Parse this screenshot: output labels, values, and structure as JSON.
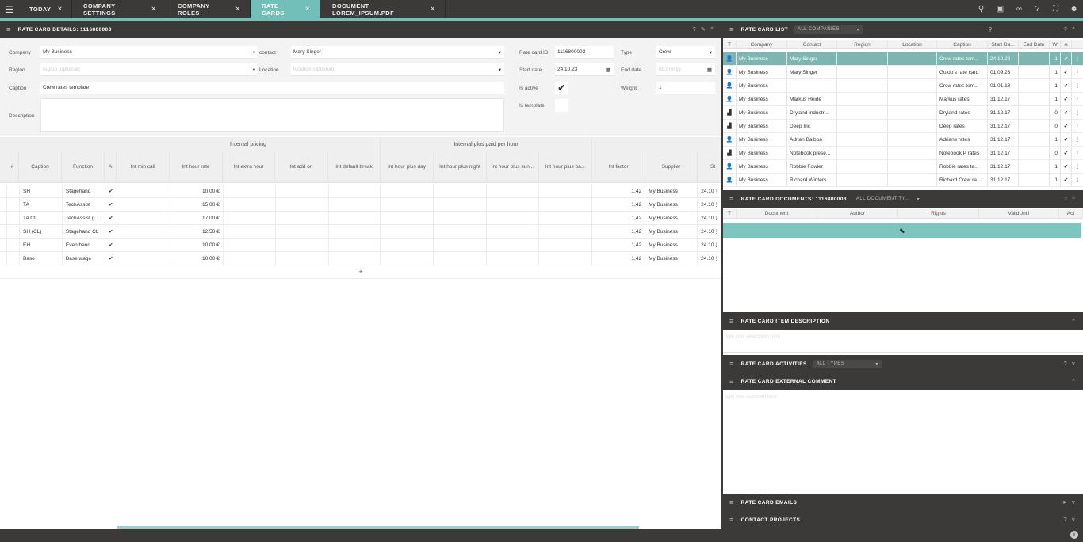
{
  "tabs": [
    {
      "label": "TODAY",
      "close": "×"
    },
    {
      "label": "COMPANY SETTINGS",
      "close": "×"
    },
    {
      "label": "COMPANY ROLES",
      "close": "×"
    },
    {
      "label": "RATE CARDS",
      "close": "×"
    },
    {
      "label": "DOCUMENT LOREM_IPSUM.PDF",
      "close": "×"
    }
  ],
  "details": {
    "title": "RATE CARD DETAILS: 1116800003",
    "company_label": "Company",
    "company": "My Business",
    "contact_label": "contact",
    "contact": "Mary Singer",
    "region_label": "Region",
    "region_ph": "region (optional)",
    "location_label": "Location",
    "location_ph": "location (optional)",
    "caption_label": "Caption",
    "caption": "Crew rates template",
    "description_label": "Description",
    "id_label": "Rate card ID",
    "id": "1116800003",
    "type_label": "Type",
    "type": "Crew",
    "start_label": "Start date",
    "start": "24.10.23",
    "end_label": "End date",
    "end_ph": "dd.mm.yy",
    "active_label": "Is active",
    "weight_label": "Weight",
    "weight": "1",
    "template_label": "Is template"
  },
  "grid": {
    "group1": "Internal pricing",
    "group2": "Internal plus paid per hour",
    "columns": [
      "#",
      "Caption",
      "Function",
      "A",
      "Int min call",
      "Int hour rate",
      "Int extra hour",
      "Int add on",
      "Int default break",
      "Int hour plus day",
      "Int hour plus night",
      "Int hour plus sun...",
      "Int hour plus ba...",
      "Int factor",
      "Supplier",
      "St"
    ],
    "rows": [
      {
        "caption": "SH",
        "function": "Stagehand",
        "rate": "10,00 €",
        "factor": "1,42",
        "supplier": "My Business",
        "st": "24.10"
      },
      {
        "caption": "TA",
        "function": "TechAssist",
        "rate": "15,00 €",
        "factor": "1,42",
        "supplier": "My Business",
        "st": "24.10"
      },
      {
        "caption": "TA CL",
        "function": "TechAssist (...",
        "rate": "17,00 €",
        "factor": "1,42",
        "supplier": "My Business",
        "st": "24.10"
      },
      {
        "caption": "SH (CL)",
        "function": "Stagehand CL",
        "rate": "12,50 €",
        "factor": "1,42",
        "supplier": "My Business",
        "st": "24.10"
      },
      {
        "caption": "EH",
        "function": "Eventhand",
        "rate": "10,00 €",
        "factor": "1,42",
        "supplier": "My Business",
        "st": "24.10"
      },
      {
        "caption": "Base",
        "function": "Base wage",
        "rate": "10,00 €",
        "factor": "1,42",
        "supplier": "My Business",
        "st": "24.10"
      }
    ],
    "add": "+"
  },
  "list": {
    "title": "RATE CARD LIST",
    "filter": "ALL COMPANIES",
    "columns": [
      "T",
      "Company",
      "Contact",
      "Region",
      "Location",
      "Caption",
      "Start Da...",
      "End Date",
      "W",
      "A"
    ],
    "rows": [
      {
        "icon": "person",
        "company": "My Business",
        "contact": "Mary Singer",
        "caption": "Crew rates tem...",
        "start": "24.10.23",
        "w": "1"
      },
      {
        "icon": "person",
        "company": "My Business",
        "contact": "Mary Singer",
        "caption": "Guido's rate card",
        "start": "01.09.23",
        "w": "1"
      },
      {
        "icon": "person",
        "company": "My Business",
        "contact": "",
        "caption": "Crew rates tem...",
        "start": "01.01.18",
        "w": "1"
      },
      {
        "icon": "person",
        "company": "My Business",
        "contact": "Markus Heide",
        "caption": "Markus rates",
        "start": "31.12.17",
        "w": "1"
      },
      {
        "icon": "factory",
        "company": "My Business",
        "contact": "Dryland industri...",
        "caption": "Dryland rates",
        "start": "31.12.17",
        "w": "0"
      },
      {
        "icon": "factory",
        "company": "My Business",
        "contact": "Deep Inc",
        "caption": "Deep rates",
        "start": "31.12.17",
        "w": "0"
      },
      {
        "icon": "person",
        "company": "My Business",
        "contact": "Adrian Balboa",
        "caption": "Adrians rates",
        "start": "31.12.17",
        "w": "1"
      },
      {
        "icon": "factory",
        "company": "My Business",
        "contact": "Notebook prese...",
        "caption": "Notebook P rates",
        "start": "31.12.17",
        "w": "0"
      },
      {
        "icon": "person",
        "company": "My Business",
        "contact": "Robbie Fowler",
        "caption": "Robbie rates te...",
        "start": "31.12.17",
        "w": "1"
      },
      {
        "icon": "person",
        "company": "My Business",
        "contact": "Richard Winters",
        "caption": "Richard Crew ra...",
        "start": "31.12.17",
        "w": "1"
      }
    ]
  },
  "documents": {
    "title": "RATE CARD DOCUMENTS: 1116800003",
    "filter": "ALL DOCUMENT TY...",
    "columns": [
      "T",
      "Document",
      "Author",
      "Rights",
      "ValidUntil",
      "Act"
    ]
  },
  "item_desc": {
    "title": "RATE CARD ITEM DESCRIPTION",
    "placeholder": "type your description here"
  },
  "activities": {
    "title": "RATE CARD ACTIVITIES",
    "filter": "ALL TYPES"
  },
  "ext_comment": {
    "title": "RATE CARD EXTERNAL COMMENT",
    "placeholder": "type your comment here"
  },
  "emails": {
    "title": "RATE CARD EMAILS"
  },
  "projects": {
    "title": "CONTACT PROJECTS"
  },
  "colors": {
    "accent": "#72bfb9",
    "dark": "#3c3a39"
  }
}
